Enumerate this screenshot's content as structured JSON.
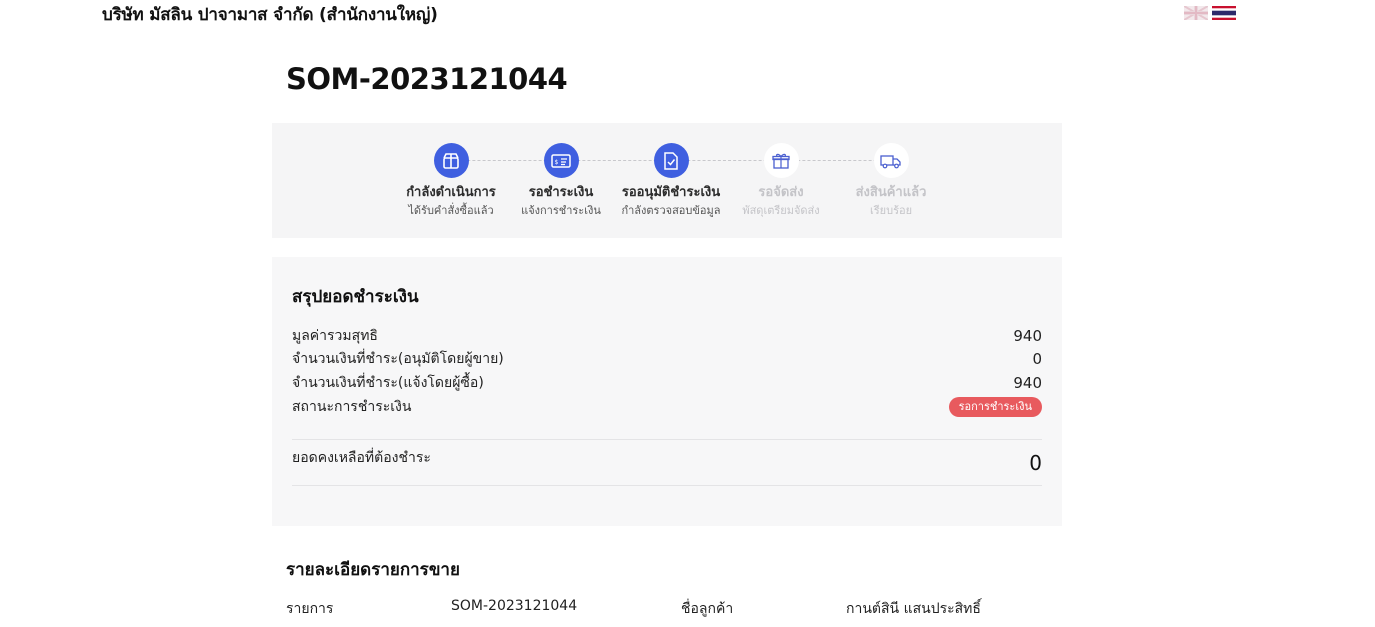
{
  "header": {
    "company_name": "บริษัท มัสลิน ปาจามาส จำกัด (สำนักงานใหญ่)",
    "languages": [
      {
        "name": "english-flag-icon"
      },
      {
        "name": "thai-flag-icon"
      }
    ]
  },
  "order": {
    "number": "SOM-2023121044"
  },
  "steps": [
    {
      "label": "กำลังดำเนินการ",
      "sub": "ได้รับคำสั่งซื้อแล้ว",
      "icon": "box-icon",
      "completed": true
    },
    {
      "label": "รอชำระเงิน",
      "sub": "แจ้งการชำระเงิน",
      "icon": "payment-card-icon",
      "completed": true
    },
    {
      "label": "รออนุมัติชำระเงิน",
      "sub": "กำลังตรวจสอบข้อมูล",
      "icon": "document-check-icon",
      "completed": true
    },
    {
      "label": "รอจัดส่ง",
      "sub": "พัสดุเตรียมจัดส่ง",
      "icon": "gift-icon",
      "completed": false
    },
    {
      "label": "ส่งสินค้าแล้ว",
      "sub": "เรียบร้อย",
      "icon": "truck-icon",
      "completed": false
    }
  ],
  "summary": {
    "title": "สรุปยอดชำระเงิน",
    "rows": [
      {
        "label": "มูลค่ารวมสุทธิ",
        "value": "940"
      },
      {
        "label": "จำนวนเงินที่ชำระ(อนุมัติโดยผู้ขาย)",
        "value": "0"
      },
      {
        "label": "จำนวนเงินที่ชำระ(แจ้งโดยผู้ซื้อ)",
        "value": "940"
      }
    ],
    "status_label": "สถานะการชำระเงิน",
    "status_badge": "รอการชำระเงิน",
    "status_color": "#e85a5e",
    "balance_label": "ยอดคงเหลือที่ต้องชำระ",
    "balance_value": "0"
  },
  "details": {
    "title": "รายละเอียดรายการขาย",
    "item_label": "รายการ",
    "item_value": "SOM-2023121044",
    "customer_label": "ชื่อลูกค้า",
    "customer_value": "กานต์สินี แสนประสิทธิ์"
  },
  "colors": {
    "accent": "#3f5fe0",
    "inactive": "#c4c4c8"
  }
}
